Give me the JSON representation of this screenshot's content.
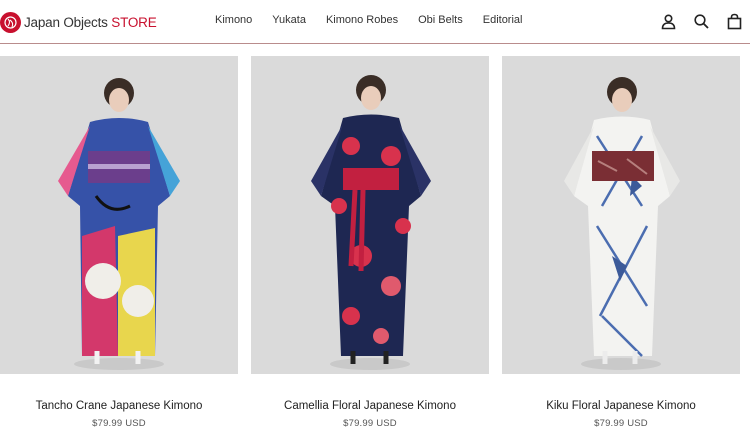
{
  "brand": {
    "name": "Japan Objects",
    "store": "STORE",
    "accent": "#c8102e"
  },
  "nav": [
    "Kimono",
    "Yukata",
    "Kimono Robes",
    "Obi Belts",
    "Editorial"
  ],
  "header_icons": [
    "account-icon",
    "search-icon",
    "cart-icon"
  ],
  "products": [
    {
      "title": "Tancho Crane Japanese Kimono",
      "price": "$79.99 USD",
      "image": "model-in-multicolour-crane-kimono"
    },
    {
      "title": "Camellia Floral Japanese Kimono",
      "price": "$79.99 USD",
      "image": "model-in-navy-camellia-kimono"
    },
    {
      "title": "Kiku Floral Japanese Kimono",
      "price": "$79.99 USD",
      "image": "model-in-white-blue-kiku-kimono"
    }
  ]
}
